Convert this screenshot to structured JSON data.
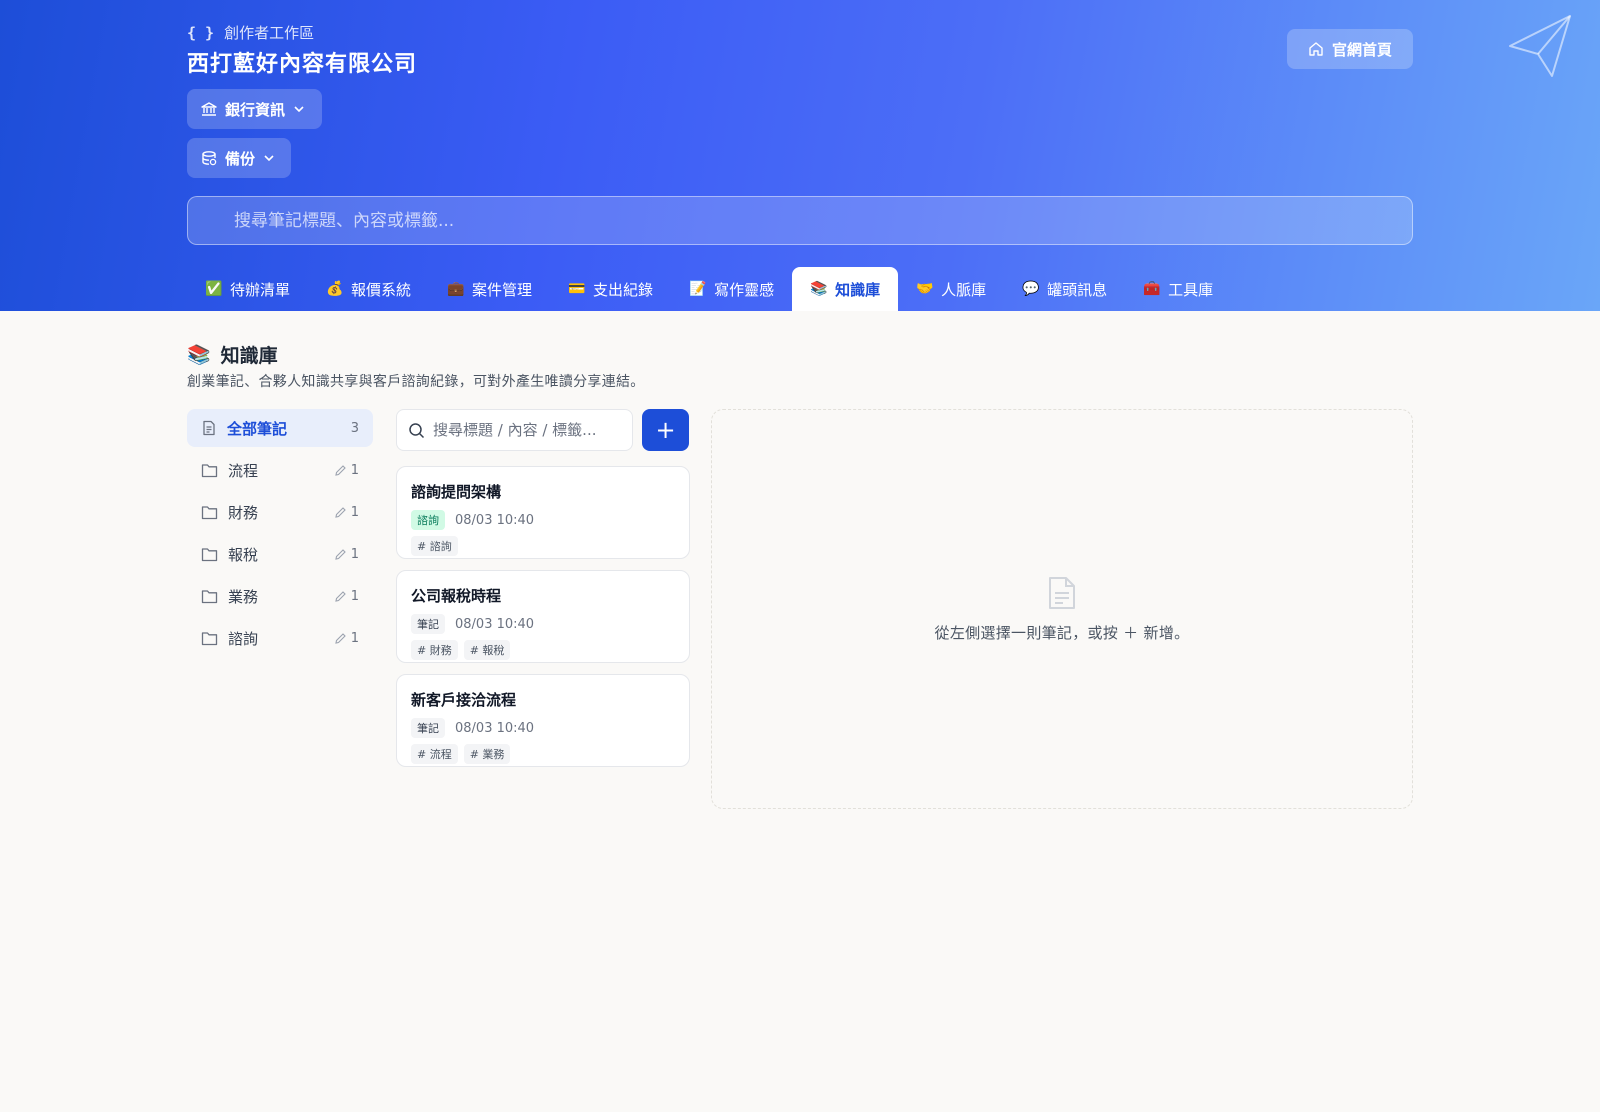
{
  "header": {
    "workspace_label": "創作者工作區",
    "company_name": "西打藍好內容有限公司",
    "bank_button": "銀行資訊",
    "backup_button": "備份",
    "home_button": "官網首頁",
    "search_placeholder": "搜尋筆記標題、內容或標籤..."
  },
  "tabs": [
    {
      "icon": "check-icon",
      "emoji": "✅",
      "label": "待辦清單"
    },
    {
      "icon": "money-bag-icon",
      "emoji": "💰",
      "label": "報價系統"
    },
    {
      "icon": "briefcase-icon",
      "emoji": "💼",
      "label": "案件管理"
    },
    {
      "icon": "credit-card-icon",
      "emoji": "💳",
      "label": "支出紀錄"
    },
    {
      "icon": "memo-icon",
      "emoji": "📝",
      "label": "寫作靈感"
    },
    {
      "icon": "books-icon",
      "emoji": "📚",
      "label": "知識庫",
      "active": true
    },
    {
      "icon": "handshake-icon",
      "emoji": "🤝",
      "label": "人脈庫"
    },
    {
      "icon": "speech-bubble-icon",
      "emoji": "💬",
      "label": "罐頭訊息"
    },
    {
      "icon": "toolbox-icon",
      "emoji": "🧰",
      "label": "工具庫"
    }
  ],
  "page": {
    "title_icon": "📚",
    "title": "知識庫",
    "subtitle": "創業筆記、合夥人知識共享與客戶諮詢紀錄，可對外產生唯讀分享連結。"
  },
  "folders": [
    {
      "name": "全部筆記",
      "count": "3",
      "active": true
    },
    {
      "name": "流程",
      "count": "1"
    },
    {
      "name": "財務",
      "count": "1"
    },
    {
      "name": "報稅",
      "count": "1"
    },
    {
      "name": "業務",
      "count": "1"
    },
    {
      "name": "諮詢",
      "count": "1"
    }
  ],
  "list": {
    "search_placeholder": "搜尋標題 / 內容 / 標籤...",
    "add_label": "+"
  },
  "notes": [
    {
      "title": "諮詢提問架構",
      "type": "諮詢",
      "type_color": "green",
      "time": "08/03 10:40",
      "tags": [
        "# 諮詢"
      ]
    },
    {
      "title": "公司報稅時程",
      "type": "筆記",
      "type_color": "gray",
      "time": "08/03 10:40",
      "tags": [
        "# 財務",
        "# 報稅"
      ]
    },
    {
      "title": "新客戶接洽流程",
      "type": "筆記",
      "type_color": "gray",
      "time": "08/03 10:40",
      "tags": [
        "# 流程",
        "# 業務"
      ]
    }
  ],
  "detail": {
    "empty_message": "從左側選擇一則筆記，或按 ＋ 新增。"
  },
  "colors": {
    "accent": "#1d4ed8",
    "header_gradient_start": "#1d4ed8",
    "header_gradient_end": "#6aa6f8"
  }
}
